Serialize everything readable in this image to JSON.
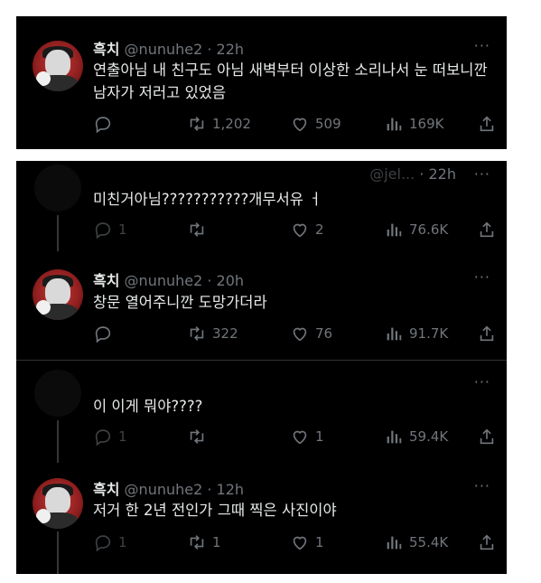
{
  "panel1": {
    "tweet": {
      "name": "흑치",
      "handle": "@nunuhe2",
      "time": "· 22h",
      "more": "···",
      "text": "연출아님 내 친구도 아님 새벽부터 이상한 소리나서 눈 떠보니깐 남자가 저러고 있었음",
      "replies": "",
      "retweets": "1,202",
      "likes": "509",
      "views": "169K"
    }
  },
  "panel2": {
    "tweets": [
      {
        "handle": "@jel...",
        "time": "· 22h",
        "more": "···",
        "text": "미친거아님???????????개무서유 ㅓ",
        "replies": "1",
        "retweets": "",
        "likes": "2",
        "views": "76.6K"
      },
      {
        "name": "흑치",
        "handle": "@nunuhe2",
        "time": "· 20h",
        "more": "···",
        "text": "창문 열어주니깐 도망가더라",
        "replies": "",
        "retweets": "322",
        "likes": "76",
        "views": "91.7K"
      },
      {
        "more": "···",
        "text": "이 이게 뭐야????",
        "replies": "1",
        "retweets": "",
        "likes": "1",
        "views": "59.4K"
      },
      {
        "name": "흑치",
        "handle": "@nunuhe2",
        "time": "· 12h",
        "more": "···",
        "text": "저거 한 2년 전인가 그때 찍은 사진이야",
        "replies": "1",
        "retweets": "1",
        "likes": "1",
        "views": "55.4K"
      }
    ]
  },
  "icons": {
    "reply": "reply-icon",
    "retweet": "retweet-icon",
    "like": "heart-icon",
    "views": "views-icon",
    "share": "share-icon"
  }
}
